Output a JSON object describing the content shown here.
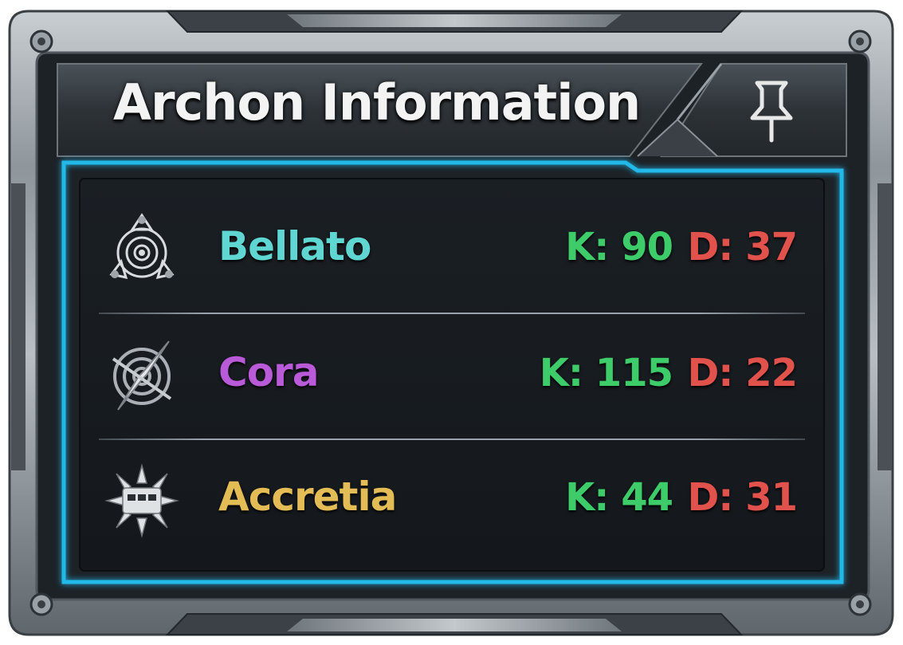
{
  "window": {
    "title": "Archon Information",
    "pin_icon": "pushpin-icon"
  },
  "factions": [
    {
      "name": "Bellato",
      "icon": "bellato-emblem-icon",
      "color": "#5fd6d2",
      "kills": "K: 90",
      "deaths": "D: 37"
    },
    {
      "name": "Cora",
      "icon": "cora-emblem-icon",
      "color": "#b95ad8",
      "kills": "K: 115",
      "deaths": "D: 22"
    },
    {
      "name": "Accretia",
      "icon": "accretia-emblem-icon",
      "color": "#e4bc55",
      "kills": "K: 44",
      "deaths": "D: 31"
    }
  ],
  "colors": {
    "kills": "#3ecb6a",
    "deaths": "#e0524b",
    "accent_glow": "#20b8e8",
    "metal": "#8c939a"
  }
}
